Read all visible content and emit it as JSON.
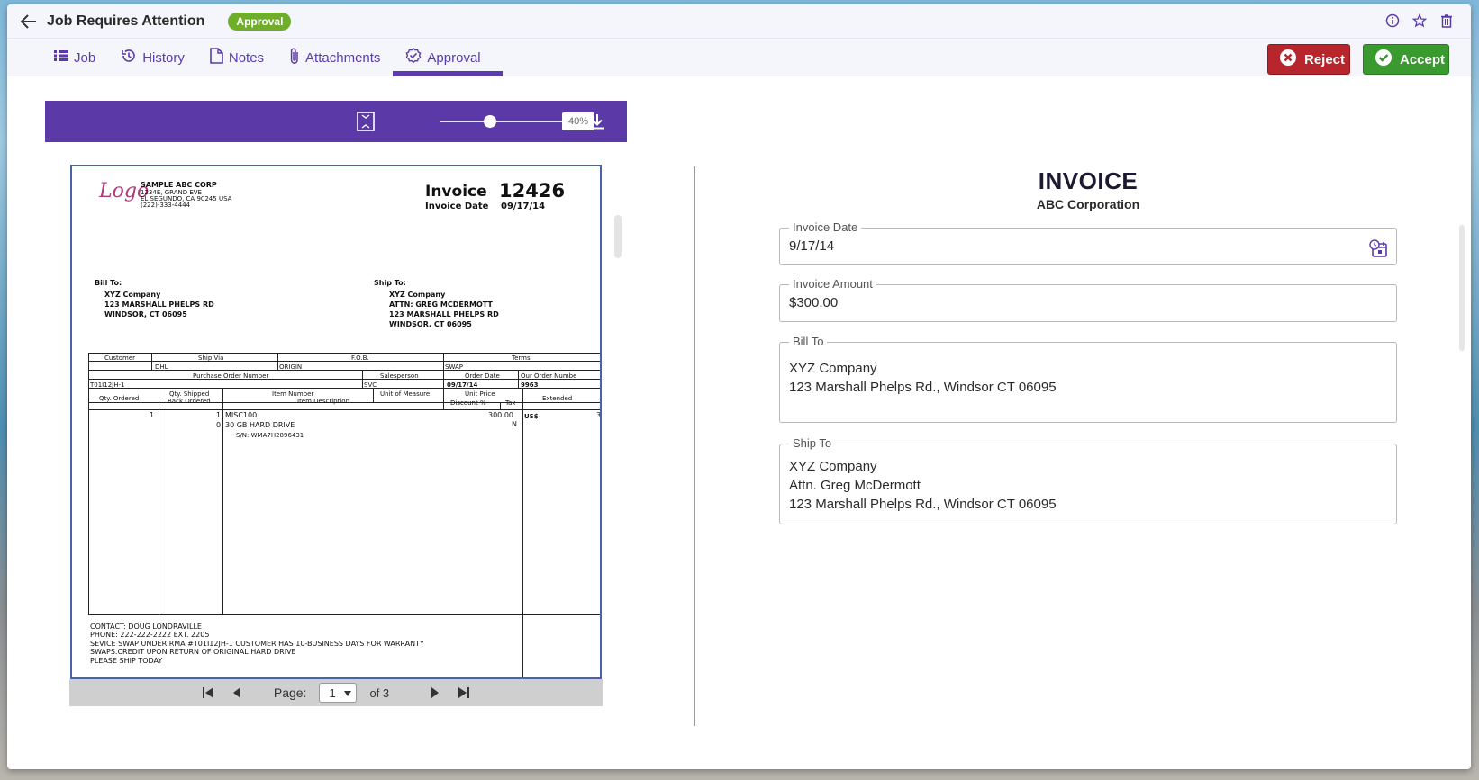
{
  "header": {
    "title": "Job Requires Attention",
    "status_badge": "Approval"
  },
  "tabs": [
    {
      "label": "Job",
      "icon": "list-icon"
    },
    {
      "label": "History",
      "icon": "history-icon"
    },
    {
      "label": "Notes",
      "icon": "document-icon"
    },
    {
      "label": "Attachments",
      "icon": "paperclip-icon"
    },
    {
      "label": "Approval",
      "icon": "approval-check-icon",
      "active": true
    }
  ],
  "actions": {
    "reject_label": "Reject",
    "accept_label": "Accept"
  },
  "viewer": {
    "zoom": "40%",
    "zoom_fraction": 0.4,
    "page_label": "Page:",
    "current_page": "1",
    "of_pages": "of 3"
  },
  "document": {
    "company": "SAMPLE ABC CORP",
    "address1": "1234E, GRAND EVE",
    "address2": "EL SEGUNDO, CA 90245 USA",
    "phone": "(222)-333-4444",
    "logo_text": "Logo",
    "invoice_label": "Invoice",
    "invoice_number": "12426",
    "invoice_date_label": "Invoice Date",
    "invoice_date": "09/17/14",
    "bill_to_label": "Bill To:",
    "bill_to": [
      "XYZ Company",
      "123 MARSHALL PHELPS RD",
      "WINDSOR, CT 06095"
    ],
    "ship_to_label": "Ship To:",
    "ship_to": [
      "XYZ Company",
      "ATTN: GREG MCDERMOTT",
      "123 MARSHALL PHELPS RD",
      "WINDSOR, CT 06095"
    ],
    "hdr_customer": "Customer",
    "hdr_ship_via": "Ship Via",
    "hdr_fob": "F.O.B.",
    "hdr_terms": "Terms",
    "val_ship_via": "DHL",
    "val_fob": "ORIGIN",
    "val_terms": "SWAP",
    "hdr_po": "Purchase Order Number",
    "hdr_salesperson": "Salesperson",
    "hdr_order_date": "Order Date",
    "hdr_our_order": "Our Order Numbe",
    "val_po": "T01I12JH-1",
    "val_salesperson": "SVC",
    "val_order_date": "09/17/14",
    "val_our_order": "9963",
    "hdr_qty_ordered": "Qty. Ordered",
    "hdr_qty_shipped": "Qty. Shipped",
    "hdr_back_ordered": "Back Ordered",
    "hdr_item_number": "Item Number",
    "hdr_item_desc": "Item Description",
    "hdr_uom": "Unit of Measure",
    "hdr_unit_price": "Unit Price",
    "hdr_discount": "Discount %",
    "hdr_tax": "Tax",
    "hdr_extended": "Extended",
    "line_qty_ordered": "1",
    "line_qty_shipped": "1",
    "line_back_ordered": "0",
    "line_item": "MISC100",
    "line_desc": "30 GB HARD DRIVE",
    "line_sn": "S/N: WMA7H2896431",
    "line_price": "300.00",
    "line_tax": "N",
    "line_currency": "US$",
    "line_ext": "3",
    "notes": [
      "CONTACT: DOUG LONDRAVILLE",
      "PHONE:  222-222-2222 EXT. 2205",
      "SEVICE SWAP UNDER RMA #T01I12JH-1 CUSTOMER HAS 10-BUSINESS DAYS FOR WARRANTY",
      "SWAPS.CREDIT UPON RETURN OF ORIGINAL HARD DRIVE",
      "PLEASE SHIP TODAY"
    ]
  },
  "form": {
    "title": "INVOICE",
    "subtitle": "ABC Corporation",
    "invoice_date_label": "Invoice Date",
    "invoice_date": "9/17/14",
    "invoice_amount_label": "Invoice Amount",
    "invoice_amount": "$300.00",
    "bill_to_label": "Bill To",
    "bill_to": "XYZ Company\n123 Marshall Phelps Rd., Windsor CT 06095",
    "ship_to_label": "Ship To",
    "ship_to": "XYZ Company\nAttn. Greg McDermott\n123 Marshall Phelps Rd., Windsor CT 06095"
  },
  "colors": {
    "accent": "#5b3aa8",
    "reject": "#b7252d",
    "accept": "#3b9a2f",
    "badge": "#6fae2a"
  }
}
